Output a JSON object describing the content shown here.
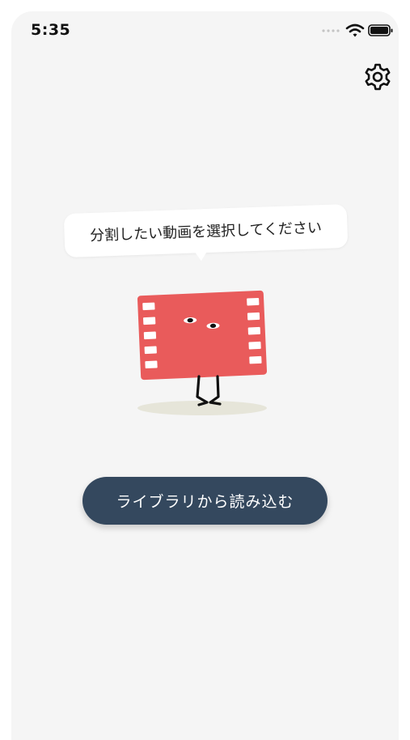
{
  "status_bar": {
    "time": "5:35",
    "icons": [
      "signal-icon",
      "wifi-icon",
      "battery-icon"
    ]
  },
  "toolbar": {
    "settings_icon": "gear-icon"
  },
  "prompt": {
    "message": "分割したい動画を選択してください"
  },
  "mascot": {
    "icon": "film-strip-character",
    "color": "#e95b5b"
  },
  "actions": {
    "import_label": "ライブラリから読み込む",
    "import_color": "#34485e"
  }
}
